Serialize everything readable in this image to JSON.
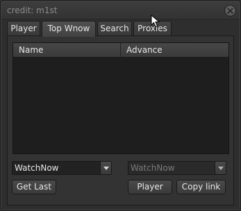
{
  "window": {
    "title": "credit: m1st"
  },
  "tabs": [
    {
      "label": "Player"
    },
    {
      "label": "Top Wnow"
    },
    {
      "label": "Search"
    },
    {
      "label": "Proxies"
    }
  ],
  "table": {
    "columns": [
      "Name",
      "Advance"
    ]
  },
  "left_combo": {
    "value": "WatchNow"
  },
  "right_combo": {
    "value": "WatchNow"
  },
  "buttons": {
    "get_last": "Get Last",
    "player": "Player",
    "copy_link": "Copy link"
  },
  "icons": {
    "close": "close-icon",
    "dropdown": "chevron-down-icon"
  }
}
